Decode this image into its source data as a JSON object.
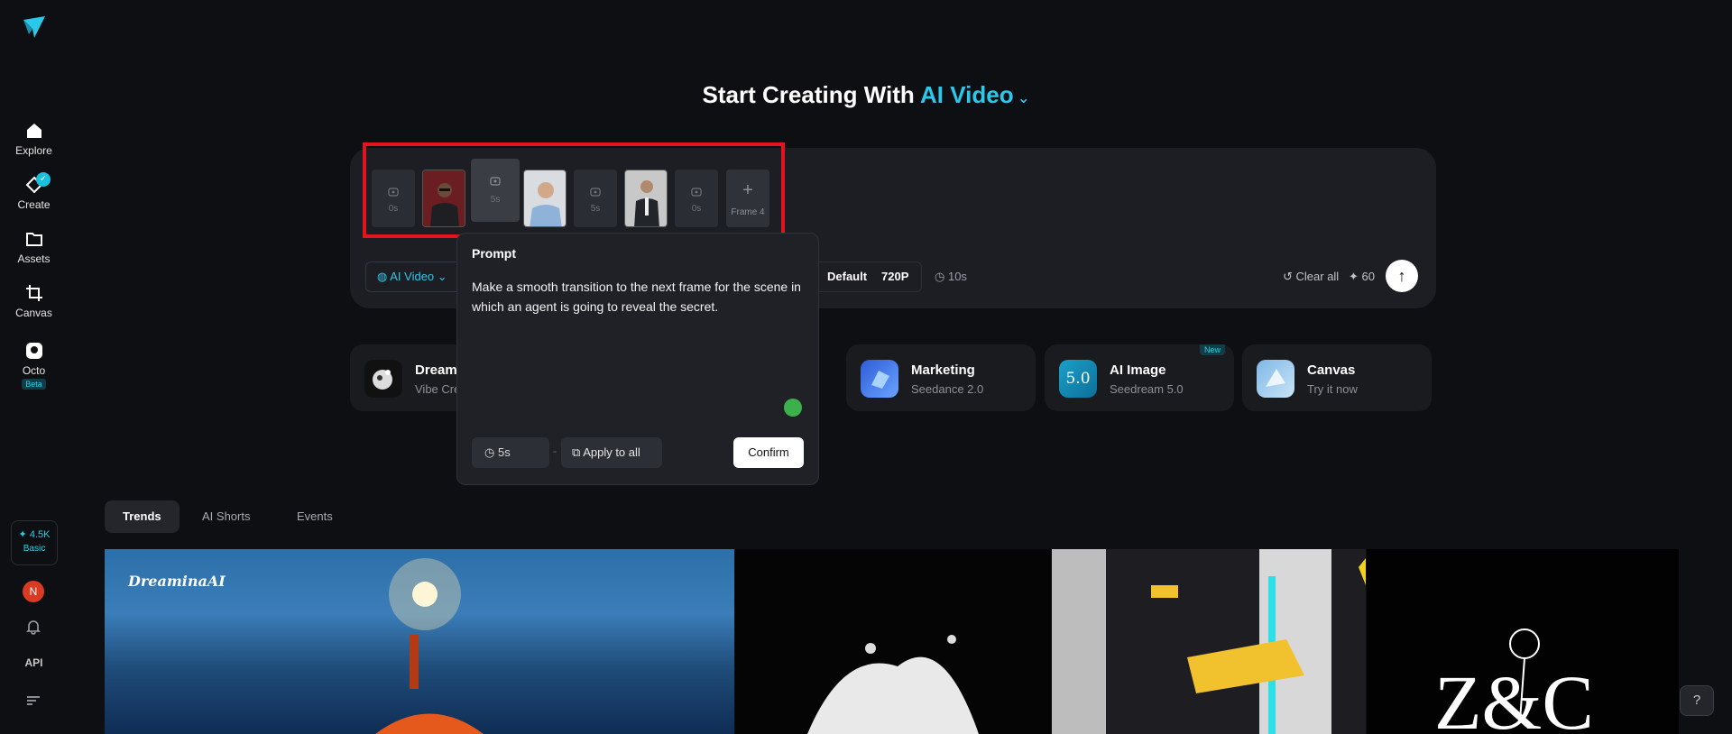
{
  "sidebar": {
    "items": [
      {
        "label": "Explore"
      },
      {
        "label": "Create"
      },
      {
        "label": "Assets"
      },
      {
        "label": "Canvas"
      },
      {
        "label": "Octo",
        "badge": "Beta"
      }
    ],
    "credits": {
      "amount": "✦ 4.5K",
      "tier": "Basic"
    },
    "avatar_initial": "N",
    "api_label": "API"
  },
  "hero": {
    "prefix": "Start Creating With",
    "mode": "AI Video"
  },
  "frames": [
    {
      "type": "slot",
      "duration": "0s"
    },
    {
      "type": "image",
      "name": "agent-portrait"
    },
    {
      "type": "slot",
      "duration": "5s",
      "selected": true
    },
    {
      "type": "image",
      "name": "man-portrait"
    },
    {
      "type": "slot",
      "duration": "5s"
    },
    {
      "type": "image",
      "name": "suit-portrait"
    },
    {
      "type": "slot",
      "duration": "0s"
    }
  ],
  "add_frame_label": "Frame 4",
  "controls": {
    "model_label": "AI Video",
    "ratio_label": "Default",
    "resolution_label": "720P",
    "duration_label": "10s",
    "clear_label": "Clear all",
    "cost": "60"
  },
  "popup": {
    "title": "Prompt",
    "text": "Make a smooth transition to the next frame for the scene in which an agent is going to reveal the secret.",
    "duration": "5s",
    "apply_label": "Apply to all",
    "confirm_label": "Confirm"
  },
  "cards": [
    {
      "title": "Dreami",
      "sub": "Vibe Cre"
    },
    {
      "title": "Marketing",
      "sub": "Seedance 2.0"
    },
    {
      "title": "AI Image",
      "sub": "Seedream 5.0",
      "badge": "New",
      "icon_text": "5.0"
    },
    {
      "title": "Canvas",
      "sub": "Try it now"
    }
  ],
  "tabs": [
    {
      "label": "Trends",
      "active": true
    },
    {
      "label": "AI Shorts"
    },
    {
      "label": "Events"
    }
  ],
  "gallery": {
    "logo_text": "DreaminaAI",
    "zc_text": "Z&C"
  },
  "colors": {
    "accent": "#2bc8ea",
    "highlight": "#e3141f",
    "bg": "#0e0f12"
  }
}
